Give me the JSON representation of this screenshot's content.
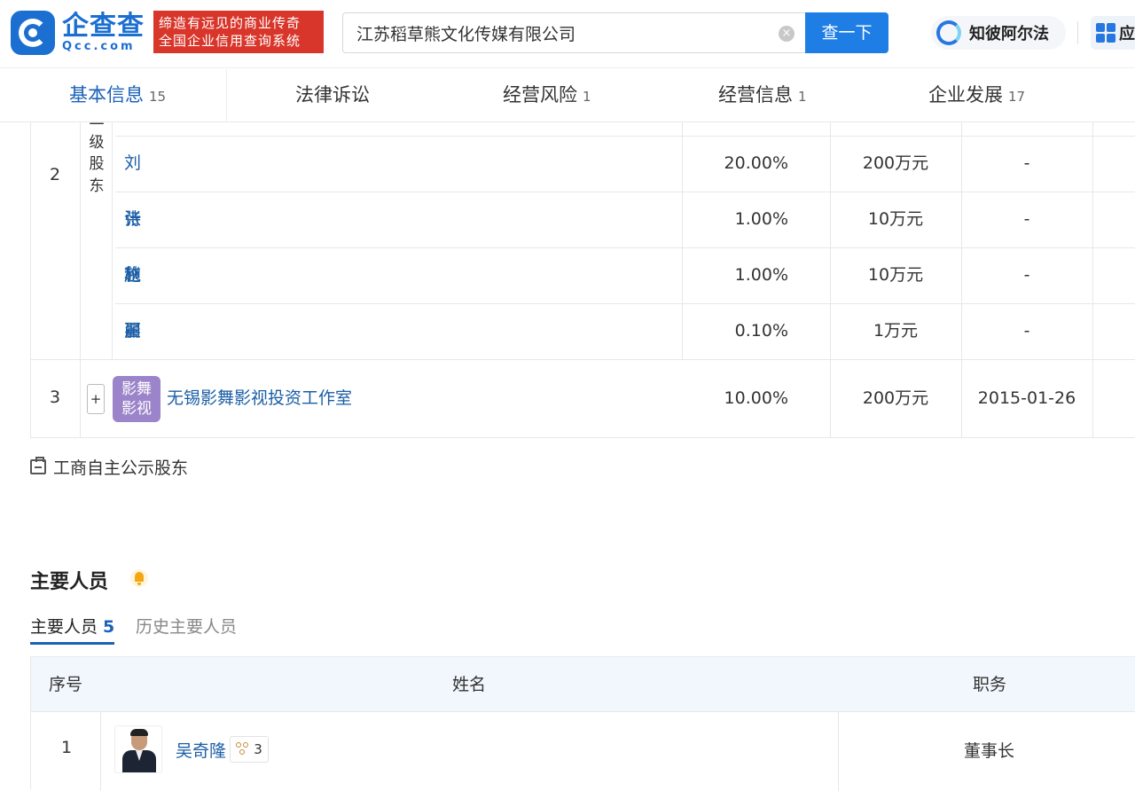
{
  "header": {
    "logo_cn": "企查查",
    "logo_en": "Qcc.com",
    "slogan_line1": "缔造有远见的商业传奇",
    "slogan_line2": "全国企业信用查询系统",
    "search_value": "江苏稻草熊文化传媒有限公司",
    "search_button": "查一下",
    "zhibi_label": "知彼阿尔法",
    "app_label": "应"
  },
  "tabs": [
    {
      "label": "基本信息",
      "count": "15"
    },
    {
      "label": "法律诉讼",
      "count": ""
    },
    {
      "label": "经营风险",
      "count": "1"
    },
    {
      "label": "经营信息",
      "count": "1"
    },
    {
      "label": "企业发展",
      "count": "17"
    }
  ],
  "shareholders": {
    "row2_index": "2",
    "level_label": [
      "一",
      "级",
      "股",
      "东"
    ],
    "sub_rows": [
      {
        "name": "刘诗施",
        "ratio": "20.00%",
        "amount": "200万元",
        "date": "-"
      },
      {
        "name": "张秋晨",
        "ratio": "1.00%",
        "amount": "10万元",
        "date": "-"
      },
      {
        "name": "赵丽颖",
        "ratio": "1.00%",
        "amount": "10万元",
        "date": "-"
      },
      {
        "name": "翟芳",
        "ratio": "0.10%",
        "amount": "1万元",
        "date": "-"
      }
    ],
    "row3": {
      "index": "3",
      "expand": "+",
      "logo_text_1": "影舞",
      "logo_text_2": "影视",
      "name": "无锡影舞影视投资工作室",
      "ratio": "10.00%",
      "amount": "200万元",
      "date": "2015-01-26"
    }
  },
  "public_link": "工商自主公示股东",
  "personnel": {
    "title": "主要人员",
    "tab_active": "主要人员",
    "tab_active_count": "5",
    "tab_inactive": "历史主要人员",
    "headers": {
      "index": "序号",
      "name": "姓名",
      "role": "职务"
    },
    "rows": [
      {
        "index": "1",
        "name": "吴奇隆",
        "relations": "3",
        "role": "董事长"
      }
    ]
  }
}
